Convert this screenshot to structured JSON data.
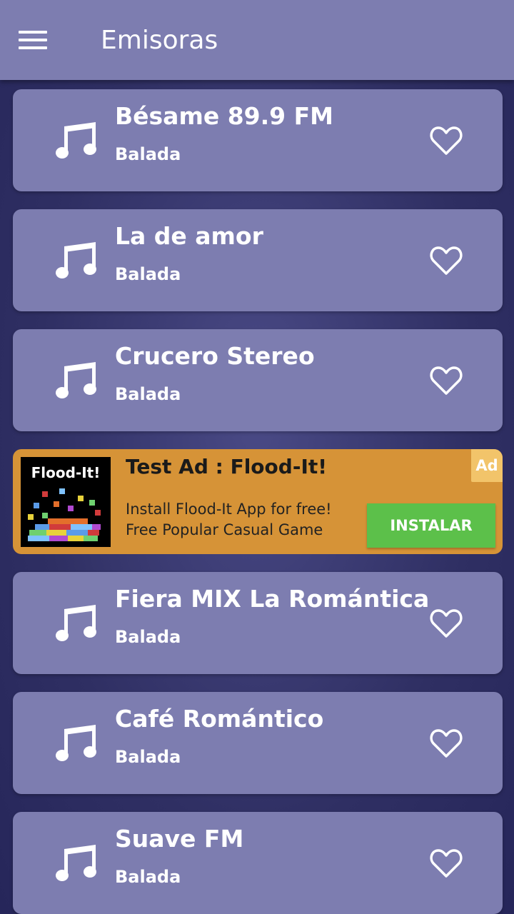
{
  "appbar": {
    "title": "Emisoras",
    "menu_icon": "hamburger-menu-icon"
  },
  "stations": [
    {
      "name": "Bésame 89.9 FM",
      "genre": "Balada"
    },
    {
      "name": "La de amor",
      "genre": "Balada"
    },
    {
      "name": "Crucero Stereo",
      "genre": "Balada"
    },
    {
      "name": "Fiera MIX La Romántica",
      "genre": "Balada"
    },
    {
      "name": "Café Romántico",
      "genre": "Balada"
    },
    {
      "name": "Suave FM",
      "genre": "Balada"
    }
  ],
  "ad": {
    "logo_text": "Flood-It!",
    "title": "Test Ad : Flood-It!",
    "badge": "Ad",
    "body_line1": "Install Flood-It App for free!",
    "body_line2": "Free Popular Casual Game",
    "cta": "INSTALAR"
  },
  "colors": {
    "surface": "#7d7db0",
    "background": "#2f2f63",
    "ad_background": "#d69337",
    "ad_cta": "#5cc04a",
    "ad_badge": "#f2c46a"
  }
}
